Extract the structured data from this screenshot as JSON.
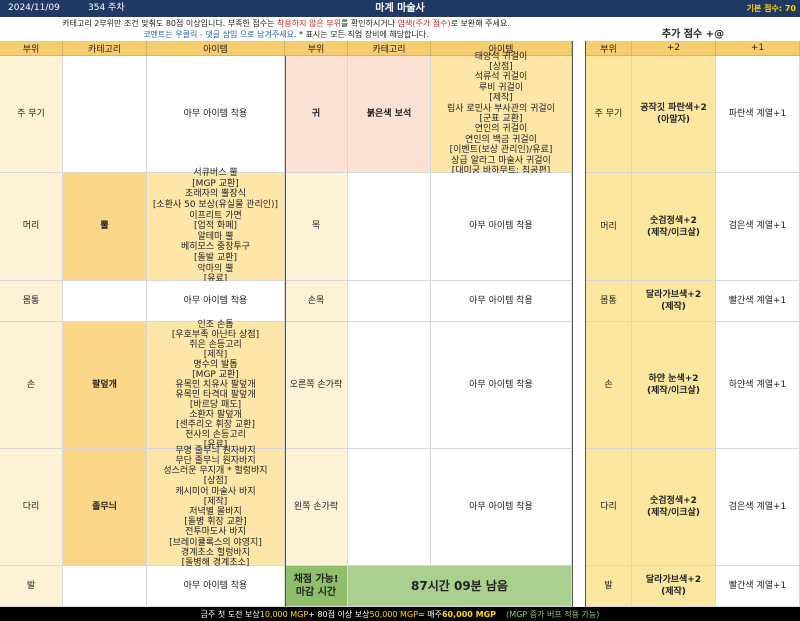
{
  "topbar": {
    "date": "2024/11/09",
    "week": "354 주차",
    "title": "마계 마술사",
    "base_score": "기본 점수: 70"
  },
  "notice": {
    "line1_a": "카테고리 2부위만 조건 맞춰도 80점 이상입니다. 부족한 점수는 ",
    "line1_red": "착용하지 않은 부위",
    "line1_b": "를 확인하시거나 ",
    "line1_red2": "염색(주가 점수)",
    "line1_c": "로 보완해 주세요.",
    "line2_blue": "코멘트는 우클릭 - 댓글 삽입 으로 남겨주세요.",
    "line2_b": " * 표시는 모든 직업 장비에 해당합니다."
  },
  "headers": {
    "slot": "부위",
    "category": "카테고리",
    "item": "아이템",
    "bonus_title": "추가 점수 +@",
    "plus2": "+2",
    "plus1": "+1"
  },
  "left_rows": [
    {
      "slot": "주 무기",
      "category": "",
      "items": "아무 아이템 착용"
    },
    {
      "slot": "머리",
      "category": "뿔",
      "items": "서큐버스 뿔\n[MGP 교환]\n초래자의 뿔장식\n[소환사 50 보상(유실물 관리인)]\n이프리트 가면\n[업적 화폐]\n알테마 뿔\n베히모스 중장투구\n[돌발 교환]\n악마의 뿔\n[유료]"
    },
    {
      "slot": "몸통",
      "category": "",
      "items": "아무 아이템 착용"
    },
    {
      "slot": "손",
      "category": "팔덮개",
      "items": "인조 손톱\n[우호부족 아난타 상점]\n쥐은 손등고리\n[제작]\n명수의 발톱\n[MGP 교환]\n유목민 치유사 팔덮개\n유목민 타격대 팔덮개\n[바르당 패도]\n소환자 팔덮개\n[센주리오 휘장 교환]\n천사의 손등고리\n[유료]"
    },
    {
      "slot": "다리",
      "category": "졸무늬",
      "items": "무명 줄무늬 원자바지\n무단 줄무늬 원자바지\n성스러운 무지개 * 헐렁바지\n[상점]\n캐시미어 마술사 바지\n[제작]\n저녁별 몰바지\n[돌병 휘장 교환]\n전투마도사 바지\n[브레이큘록스의 야영지]\n경계초소 헐렁바지\n[돌병해 경계초소]"
    },
    {
      "slot": "발",
      "category": "",
      "items": "아무 아이템 착용"
    }
  ],
  "mid_rows": [
    {
      "slot": "귀",
      "category": "붉은색 보석",
      "items": "태양석 귀걸이\n[상점]\n석류석 귀걸이\n루비 귀걸이\n[제작]\n림사 로민사 부사관의 귀걸이\n[군표 교환]\n연인의 귀걸이\n연인의 백금 귀걸이\n[이벤트(보상 관리인)/유료]\n상급 알라그 마술사 귀걸이\n[대미궁 바하무트: 침공편]"
    },
    {
      "slot": "목",
      "category": "",
      "items": "아무 아이템 착용"
    },
    {
      "slot": "손목",
      "category": "",
      "items": "아무 아이템 착용"
    },
    {
      "slot": "오른쪽 손가락",
      "category": "",
      "items": "아무 아이템 착용"
    },
    {
      "slot": "왼쪽 손가락",
      "category": "",
      "items": "아무 아이템 착용"
    }
  ],
  "status": {
    "scoring": "채점 가능!\n마감 시간",
    "remaining": "87시간 09분 남음"
  },
  "bonus_rows": [
    {
      "slot": "주 무기",
      "plus2": "공작깃 파란색+2\n(아말자)",
      "plus1": "파란색 계열+1"
    },
    {
      "slot": "머리",
      "plus2": "숫검정색+2\n(제작/이크살)",
      "plus1": "검은색 계열+1"
    },
    {
      "slot": "몸통",
      "plus2": "달라가브색+2\n(제작)",
      "plus1": "빨간색 계열+1"
    },
    {
      "slot": "손",
      "plus2": "하얀 눈색+2\n(제작/이크살)",
      "plus1": "하얀색 계열+1"
    },
    {
      "slot": "다리",
      "plus2": "숫검정색+2\n(제작/이크살)",
      "plus1": "검은색 계열+1"
    },
    {
      "slot": "발",
      "plus2": "달라가브색+2\n(제작)",
      "plus1": "빨간색 계열+1"
    }
  ],
  "footer": {
    "a": "금주 첫 도전 보상 ",
    "b": "10,000 MGP",
    "c": " + 80점 이상 보상 ",
    "d": "50,000 MGP",
    "e": " = 매주 ",
    "f": "60,000 MGP",
    "g": "    (MGP 증가 버프 적용 가능)"
  },
  "colors": {
    "topbar": "#1f3864",
    "header": "#f5cd6e",
    "accent_red": "#e02020",
    "accent_blue": "#2060c0",
    "green": "#a9d08e",
    "gold_text": "#ffd800"
  }
}
